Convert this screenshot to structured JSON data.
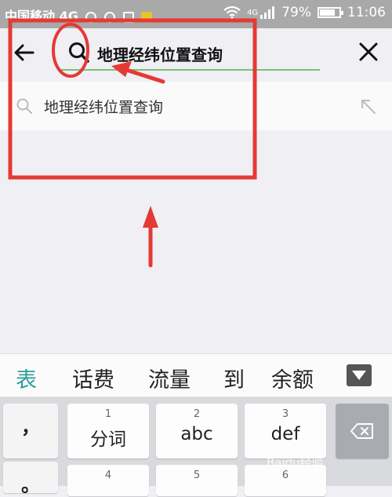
{
  "status_bar": {
    "carrier": "中国移动 4G",
    "network": "4G",
    "battery": "79%",
    "battery_level": 0.79,
    "time": "11:06"
  },
  "search": {
    "back_icon": "back-arrow-icon",
    "query": "地理经纬位置查询",
    "close_icon": "close-icon"
  },
  "suggestions": [
    {
      "text": "地理经纬位置查询",
      "icon": "search-icon",
      "action_icon": "fill-arrow-icon"
    }
  ],
  "candidates": [
    "表",
    "话费",
    "流量",
    "到",
    "余额"
  ],
  "keyboard": {
    "punct_keys": [
      "，",
      "。"
    ],
    "rows": [
      [
        {
          "num": "1",
          "label": "分词"
        },
        {
          "num": "2",
          "label": "abc"
        },
        {
          "num": "3",
          "label": "def"
        }
      ],
      [
        {
          "num": "4",
          "label": ""
        },
        {
          "num": "5",
          "label": ""
        },
        {
          "num": "6",
          "label": ""
        }
      ]
    ]
  },
  "watermark": "Baidu经验",
  "colors": {
    "accent_green": "#7dbf7d",
    "annotation_red": "#e53935",
    "candidate_highlight": "#2a9d9b",
    "status_bar_bg": "#a9a9a9"
  }
}
